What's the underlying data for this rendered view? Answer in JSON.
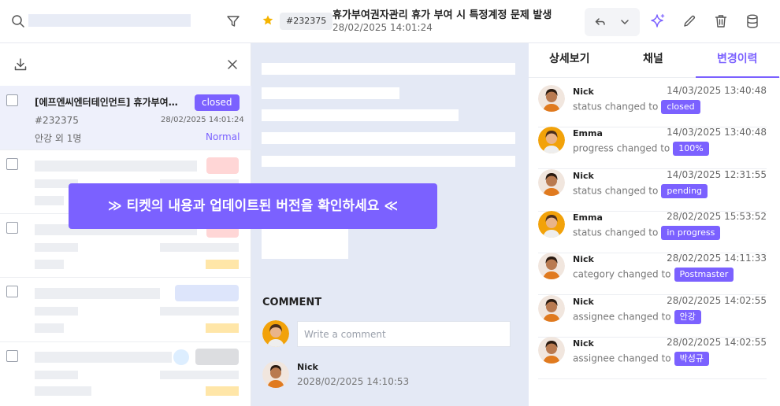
{
  "topbar": {
    "search": {
      "placeholder": ""
    },
    "ticket_id": "#232375",
    "ticket_title": "휴가부여권자관리 휴가 부여 시 특정계정 문제 발생",
    "ticket_time": "28/02/2025 14:01:24",
    "icons": [
      "search-icon",
      "filter-icon",
      "star-icon",
      "reply-icon",
      "chevron-down-icon",
      "sparkle-icon",
      "pencil-icon",
      "trash-icon",
      "database-icon"
    ],
    "accent_color": "#7b61ff",
    "star_color": "#f5b400"
  },
  "ticket_list": {
    "items": [
      {
        "title": "[에프엔씨엔터테인먼트] 휴가부여…",
        "status": "closed",
        "id": "#232375",
        "date": "28/02/2025 14:01:24",
        "assignee": "안강 외 1명",
        "priority": "Normal",
        "selected": true
      }
    ]
  },
  "comments": {
    "section_label": "COMMENT",
    "input_placeholder": "Write a comment",
    "entries": [
      {
        "author": "Nick",
        "date": "2028/02/2025 14:10:53"
      }
    ]
  },
  "detail_tabs": {
    "tabs": [
      "상세보기",
      "채널",
      "변경이력"
    ],
    "active": "변경이력"
  },
  "history": [
    {
      "name": "Nick",
      "date": "14/03/2025 13:40:48",
      "action": "status changed to",
      "value": "closed"
    },
    {
      "name": "Emma",
      "date": "14/03/2025 13:40:48",
      "action": "progress changed to",
      "value": "100%"
    },
    {
      "name": "Nick",
      "date": "14/03/2025 12:31:55",
      "action": "status changed to",
      "value": "pending"
    },
    {
      "name": "Emma",
      "date": "28/02/2025 15:53:52",
      "action": "status changed to",
      "value": "in progress"
    },
    {
      "name": "Nick",
      "date": "28/02/2025 14:11:33",
      "action": "category changed to",
      "value": "Postmaster"
    },
    {
      "name": "Nick",
      "date": "28/02/2025 14:02:55",
      "action": "assignee changed to",
      "value": "안강"
    },
    {
      "name": "Nick",
      "date": "28/02/2025 14:02:55",
      "action": "assignee changed to",
      "value": "박성규"
    }
  ],
  "banner": {
    "text": "≫ 티켓의 내용과 업데이트된 버전을 확인하세요 ≪"
  }
}
